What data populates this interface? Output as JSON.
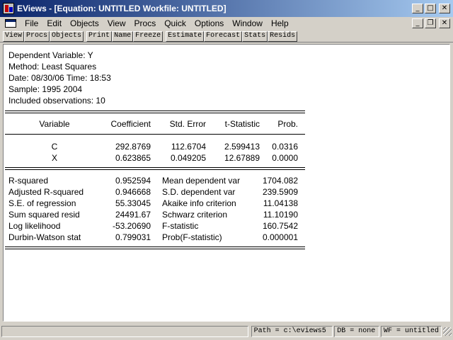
{
  "window": {
    "title": "EViews - [Equation: UNTITLED    Workfile: UNTITLED]",
    "min_symbol": "_",
    "max_symbol": "□",
    "close_symbol": "✕",
    "restore_symbol": "❐"
  },
  "menu": {
    "items": [
      "File",
      "Edit",
      "Objects",
      "View",
      "Procs",
      "Quick",
      "Options",
      "Window",
      "Help"
    ]
  },
  "toolbar": {
    "buttons": [
      "View",
      "Procs",
      "Objects",
      "Print",
      "Name",
      "Freeze",
      "Estimate",
      "Forecast",
      "Stats",
      "Resids"
    ]
  },
  "header": {
    "dependent": "Dependent Variable: Y",
    "method": "Method: Least Squares",
    "datetime": "Date: 08/30/06   Time: 18:53",
    "sample": "Sample: 1995 2004",
    "observations": "Included observations: 10"
  },
  "coef_table": {
    "columns": [
      "Variable",
      "Coefficient",
      "Std. Error",
      "t-Statistic",
      "Prob."
    ],
    "rows": [
      [
        "C",
        "292.8769",
        "112.6704",
        "2.599413",
        "0.0316"
      ],
      [
        "X",
        "0.623865",
        "0.049205",
        "12.67889",
        "0.0000"
      ]
    ]
  },
  "stats_table": {
    "rows": [
      [
        "R-squared",
        "0.952594",
        "Mean dependent var",
        "1704.082"
      ],
      [
        "Adjusted R-squared",
        "0.946668",
        "S.D. dependent var",
        "239.5909"
      ],
      [
        "S.E. of regression",
        "55.33045",
        "Akaike info criterion",
        "11.04138"
      ],
      [
        "Sum squared resid",
        "24491.67",
        "Schwarz criterion",
        "11.10190"
      ],
      [
        "Log likelihood",
        "-53.20690",
        "F-statistic",
        "160.7542"
      ],
      [
        "Durbin-Watson stat",
        "0.799031",
        "Prob(F-statistic)",
        "0.000001"
      ]
    ]
  },
  "status": {
    "path": "Path = c:\\eviews5",
    "db": "DB = none",
    "wf": "WF = untitled"
  }
}
